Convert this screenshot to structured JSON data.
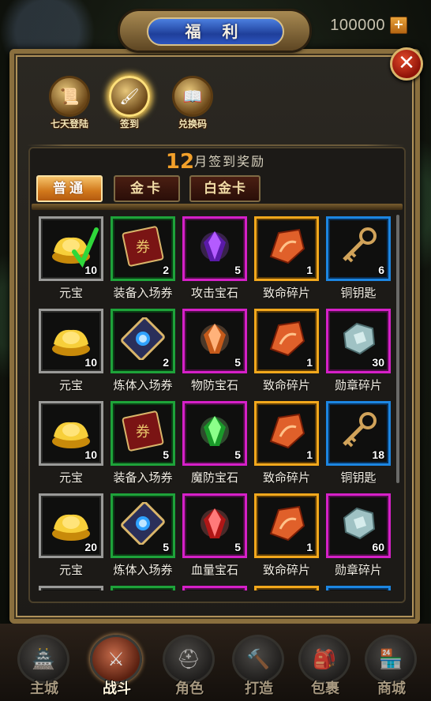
{
  "currency": {
    "value": "100000",
    "add_icon": "plus-icon"
  },
  "header": {
    "title": "福 利",
    "close_icon": "close-icon"
  },
  "top_tabs": [
    {
      "label": "七天登陆",
      "icon": "seven-day-login-icon",
      "active": false
    },
    {
      "label": "签到",
      "icon": "sign-in-scroll-icon",
      "active": true
    },
    {
      "label": "兑换码",
      "icon": "redeem-code-icon",
      "active": false
    }
  ],
  "section": {
    "month": "12",
    "title_suffix": "月签到奖励"
  },
  "sub_tabs": [
    {
      "label": "普通",
      "active": true
    },
    {
      "label": "金卡",
      "active": false
    },
    {
      "label": "白金卡",
      "active": false
    }
  ],
  "rewards": [
    [
      {
        "name": "元宝",
        "qty": "10",
        "rarity": "gray",
        "icon": "gold-ingot-icon",
        "claimed": true
      },
      {
        "name": "装备入场券",
        "qty": "2",
        "rarity": "green",
        "icon": "equipment-ticket-icon"
      },
      {
        "name": "攻击宝石",
        "qty": "5",
        "rarity": "purple",
        "icon": "purple-gem-icon"
      },
      {
        "name": "致命碎片",
        "qty": "1",
        "rarity": "gold",
        "icon": "fragment-icon"
      },
      {
        "name": "铜钥匙",
        "qty": "6",
        "rarity": "blue",
        "icon": "copper-key-icon"
      }
    ],
    [
      {
        "name": "元宝",
        "qty": "10",
        "rarity": "gray",
        "icon": "gold-ingot-icon"
      },
      {
        "name": "炼体入场券",
        "qty": "2",
        "rarity": "green",
        "icon": "refining-ticket-icon"
      },
      {
        "name": "物防宝石",
        "qty": "5",
        "rarity": "purple",
        "icon": "orange-gem-icon"
      },
      {
        "name": "致命碎片",
        "qty": "1",
        "rarity": "gold",
        "icon": "fragment-icon"
      },
      {
        "name": "勋章碎片",
        "qty": "30",
        "rarity": "purple",
        "icon": "medal-fragment-icon"
      }
    ],
    [
      {
        "name": "元宝",
        "qty": "10",
        "rarity": "gray",
        "icon": "gold-ingot-icon"
      },
      {
        "name": "装备入场券",
        "qty": "5",
        "rarity": "green",
        "icon": "equipment-ticket-icon"
      },
      {
        "name": "魔防宝石",
        "qty": "5",
        "rarity": "purple",
        "icon": "green-gem-icon"
      },
      {
        "name": "致命碎片",
        "qty": "1",
        "rarity": "gold",
        "icon": "fragment-icon"
      },
      {
        "name": "铜钥匙",
        "qty": "18",
        "rarity": "blue",
        "icon": "copper-key-icon"
      }
    ],
    [
      {
        "name": "元宝",
        "qty": "20",
        "rarity": "gray",
        "icon": "gold-ingot-icon"
      },
      {
        "name": "炼体入场券",
        "qty": "5",
        "rarity": "green",
        "icon": "refining-ticket-icon"
      },
      {
        "name": "血量宝石",
        "qty": "5",
        "rarity": "purple",
        "icon": "red-gem-icon"
      },
      {
        "name": "致命碎片",
        "qty": "1",
        "rarity": "gold",
        "icon": "fragment-icon"
      },
      {
        "name": "勋章碎片",
        "qty": "60",
        "rarity": "purple",
        "icon": "medal-fragment-icon"
      }
    ],
    [
      {
        "name": "",
        "qty": "",
        "rarity": "gray",
        "icon": ""
      },
      {
        "name": "",
        "qty": "",
        "rarity": "green",
        "icon": ""
      },
      {
        "name": "",
        "qty": "",
        "rarity": "purple",
        "icon": ""
      },
      {
        "name": "",
        "qty": "",
        "rarity": "gold",
        "icon": ""
      },
      {
        "name": "",
        "qty": "",
        "rarity": "blue",
        "icon": ""
      }
    ]
  ],
  "bottom_nav": [
    {
      "label": "主城",
      "icon": "main-city-icon",
      "active": false
    },
    {
      "label": "战斗",
      "icon": "battle-axes-icon",
      "active": true
    },
    {
      "label": "角色",
      "icon": "character-helmet-icon",
      "active": false
    },
    {
      "label": "打造",
      "icon": "forge-hammer-icon",
      "active": false
    },
    {
      "label": "包裹",
      "icon": "bag-icon",
      "active": false
    },
    {
      "label": "商城",
      "icon": "shop-icon",
      "active": false
    }
  ],
  "colors": {
    "gray": "#9a9a98",
    "green": "#1ea33a",
    "purple": "#d620c8",
    "gold": "#f2a81c",
    "blue": "#1c86e2",
    "accent": "#f2a02a"
  }
}
